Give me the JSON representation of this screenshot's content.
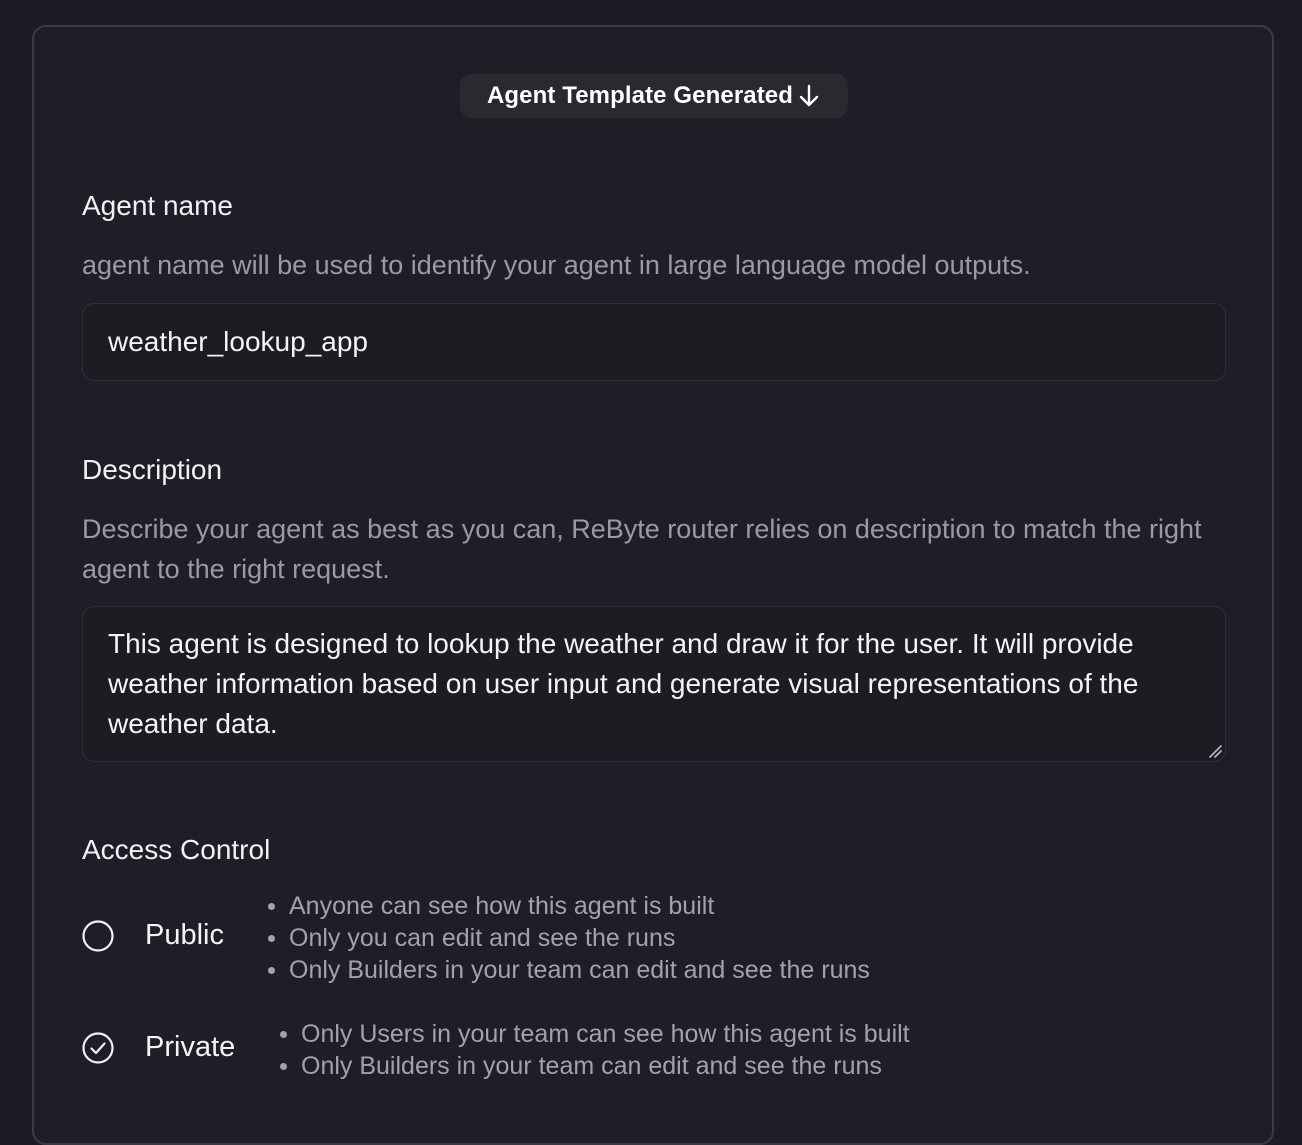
{
  "header": {
    "badge_label": "Agent Template Generated",
    "badge_icon": "arrow-down-icon"
  },
  "agent_name": {
    "label": "Agent name",
    "help": "agent name will be used to identify your agent in large language model outputs.",
    "value": "weather_lookup_app"
  },
  "description": {
    "label": "Description",
    "help": "Describe your agent as best as you can, ReByte router relies on description to match the right agent to the right request.",
    "value": "This agent is designed to lookup the weather and draw it for the user. It will provide weather information based on user input and generate visual representations of the weather data."
  },
  "access_control": {
    "label": "Access Control",
    "selected": "Private",
    "options": [
      {
        "label": "Public",
        "selected": false,
        "bullets": [
          "Anyone can see how this agent is built",
          "Only you can edit and see the runs",
          "Only Builders in your team can edit and see the runs"
        ]
      },
      {
        "label": "Private",
        "selected": true,
        "bullets": [
          "Only Users in your team can see how this agent is built",
          "Only Builders in your team can edit and see the runs"
        ]
      }
    ]
  },
  "colors": {
    "background": "#1c1d24",
    "card_border": "#3a3b43",
    "muted_text": "#9a9ba2"
  }
}
